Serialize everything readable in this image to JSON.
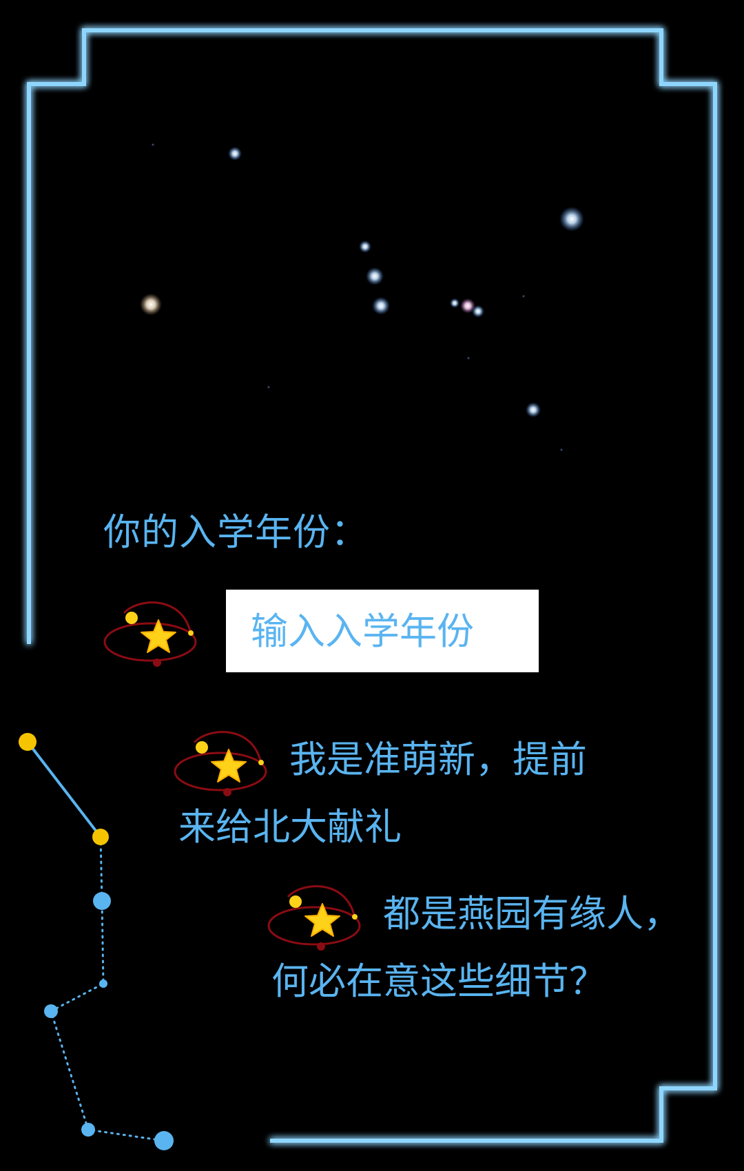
{
  "form": {
    "question": "你的入学年份：",
    "year_input_placeholder": "输入入学年份",
    "year_input_value": ""
  },
  "options": [
    {
      "line1": "我是准萌新，提前",
      "line2": "来给北大献礼"
    },
    {
      "line1": "都是燕园有缘人，",
      "line2": "何必在意这些细节？"
    }
  ],
  "colors": {
    "background": "#000000",
    "frame": "#8fd6ff",
    "frame_glow": "#2a9cff",
    "text": "#5ab4f0",
    "input_background": "#ffffff",
    "star_yellow": "#ffd21a",
    "orbit_red": "#8b0c12",
    "constellation_yellow": "#f5c400",
    "constellation_blue": "#5ab4f0"
  },
  "icons": {
    "option_marker": "star-orbit-icon",
    "decoration": "constellation-icon"
  }
}
